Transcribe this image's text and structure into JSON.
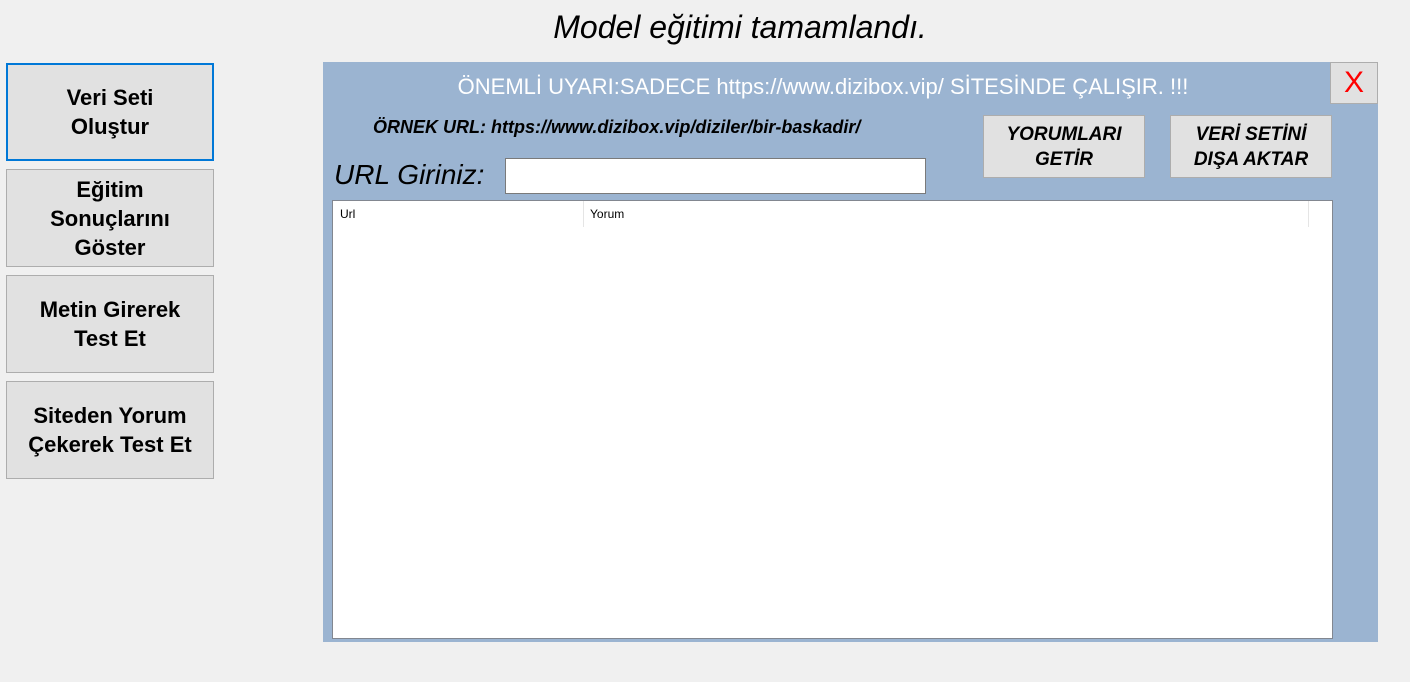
{
  "status": {
    "title": "Model eğitimi tamamlandı."
  },
  "sidebar": {
    "items": [
      {
        "label_line1": "Veri Seti",
        "label_line2": "Oluştur"
      },
      {
        "label_line1": "Eğitim",
        "label_line2": "Sonuçlarını",
        "label_line3": "Göster"
      },
      {
        "label_line1": "Metin Girerek",
        "label_line2": "Test Et"
      },
      {
        "label_line1": "Siteden Yorum",
        "label_line2": "Çekerek Test Et"
      }
    ]
  },
  "panel": {
    "warning": "ÖNEMLİ UYARI:SADECE https://www.dizibox.vip/  SİTESİNDE ÇALIŞIR. !!!",
    "close_label": "X",
    "example_url": "ÖRNEK URL: https://www.dizibox.vip/diziler/bir-baskadir/",
    "url_label": "URL Giriniz:",
    "url_value": "",
    "fetch_button": {
      "line1": "YORUMLARI",
      "line2": "GETİR"
    },
    "export_button": {
      "line1": "VERİ SETİNİ",
      "line2": "DIŞA AKTAR"
    },
    "table": {
      "columns": [
        "Url",
        "Yorum"
      ],
      "rows": []
    }
  },
  "colors": {
    "panel_bg": "#9bb4d1",
    "window_bg": "#f0f0f0",
    "close_x": "#ff0000",
    "focus_border": "#0078d7"
  }
}
